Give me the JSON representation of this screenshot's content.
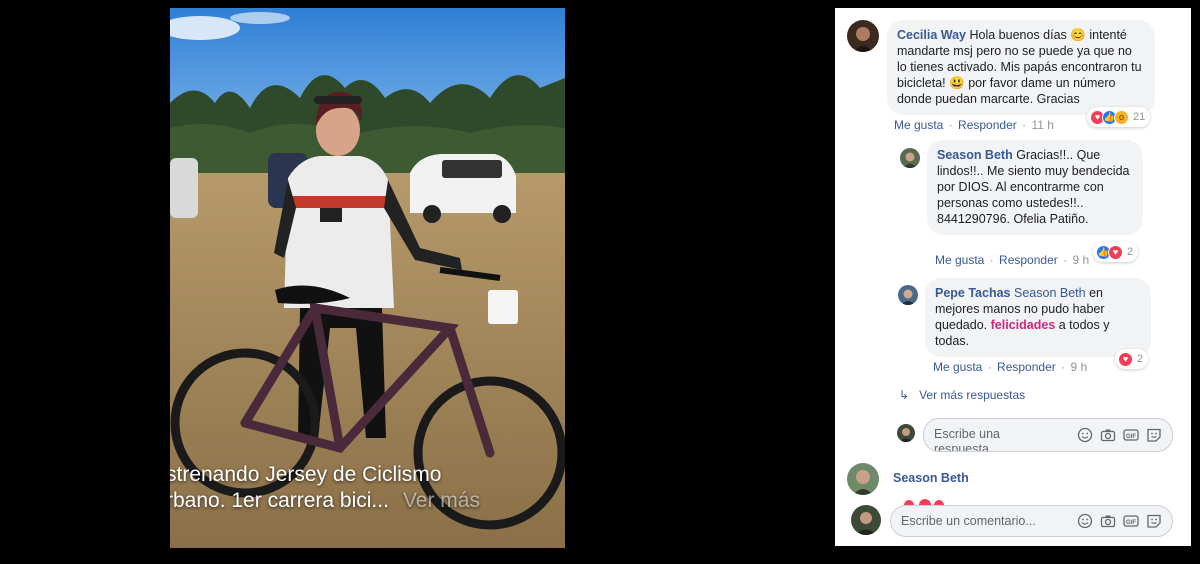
{
  "post": {
    "caption_line1": "strenando Jersey de Ciclismo",
    "caption_line2": "rbano. 1er carrera bici...",
    "caption_more": "Ver más"
  },
  "comments": [
    {
      "author": "Cecilia Way",
      "text_before_emoji": "Hola buenos días",
      "emoji1": "😊",
      "text_mid": "intenté mandarte msj pero no se puede ya que no lo tienes activado. Mis papás encontraron tu bicicleta!",
      "emoji2": "😃",
      "text_after": "por favor dame un número donde puedan marcarte. Gracias",
      "like": "Me gusta",
      "reply": "Responder",
      "time": "11 h",
      "reaction_count": "21",
      "reaction_icons": [
        "love-icon",
        "like-icon",
        "wow-icon"
      ]
    }
  ],
  "replies": [
    {
      "author": "Season Beth",
      "text": "Gracias!!.. Que lindos!!.. Me siento muy bendecida por DIOS. Al encontrarme con personas como ustedes!!.. 8441290796. Ofelia Patiño.",
      "like": "Me gusta",
      "reply": "Responder",
      "time": "9 h",
      "reaction_count": "2",
      "reaction_icons": [
        "like-icon",
        "love-icon"
      ]
    },
    {
      "author": "Pepe Tachas",
      "mention": "Season Beth",
      "text_before": "en mejores manos no pudo haber quedado.",
      "highlight": "felicidades",
      "text_after": "a todos y todas.",
      "like": "Me gusta",
      "reply": "Responder",
      "time": "9 h",
      "reaction_count": "2",
      "reaction_icons": [
        "love-icon"
      ]
    }
  ],
  "more_replies": "Ver más respuestas",
  "reply_input_placeholder": "Escribe una respuesta...",
  "next_comment_author": "Season Beth",
  "comment_input_placeholder": "Escribe un comentario...",
  "colors": {
    "link": "#385898",
    "bubble": "#f2f3f5",
    "highlight": "#d6247e"
  }
}
